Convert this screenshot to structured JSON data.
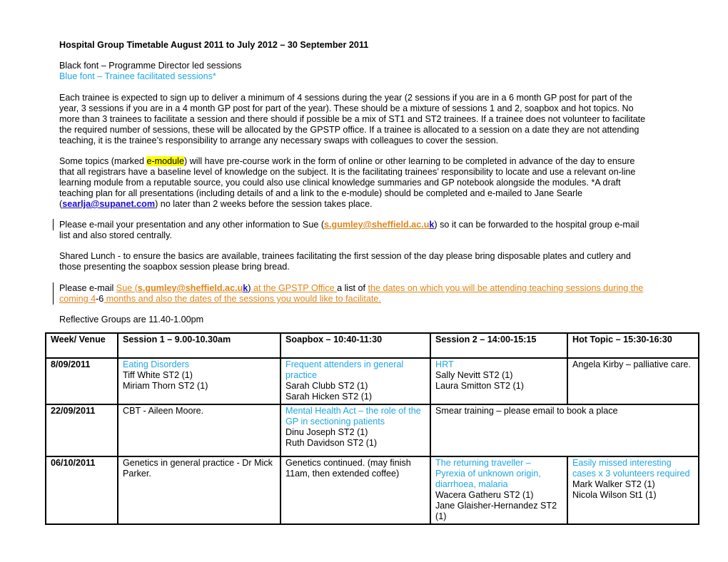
{
  "document": {
    "title": "Hospital Group Timetable August 2011 to July 2012 – 30 September 2011",
    "legend": {
      "black": "Black font – Programme Director led sessions",
      "blue": "Blue font – Trainee facilitated sessions*"
    },
    "paragraph_trainee_lines": [
      "Each trainee is expected to sign up to deliver a minimum of 4 sessions during the year (2 sessions if you are in a 6 month GP post for part of the",
      "year, 3 sessions if you are in a 4 month GP post for part of the year).  These should be a mixture of sessions 1 and 2, soapbox and hot topics. No",
      "more than 3 trainees to facilitate a session and there should if possible be a mix of ST1 and ST2 trainees.  If a trainee does not volunteer to facilitate",
      "the required number of sessions, these will be allocated by the GPSTP office.  If a trainee is allocated to a session on a date they are not attending",
      "teaching, it is the trainee’s responsibility to arrange any necessary swaps with colleagues to cover the session."
    ],
    "emodule": {
      "line1_before": "Some topics (marked ",
      "highlight": "e-module",
      "line1_after": ") will have pre-course work in the form of online or other learning to be completed in advance of the day to ensure",
      "line2": "that all registrars have a baseline level of knowledge on the subject. It is the facilitating trainees’ responsibility to locate and use a relevant on-line",
      "line3": "learning module from a reputable source, you could also use clinical knowledge summaries and GP notebook alongside the modules.  *A draft",
      "line4": "teaching plan for all presentations (including details of and a link to the e-module) should be completed and e-mailed to Jane Searle",
      "line5_open": "(",
      "email": "searlja@supanet.com",
      "line5_after": ") no later than 2 weeks before the session takes place."
    },
    "presentation": {
      "before": "Please e-mail your presentation and any other information to Sue (",
      "email_orange": "s.gumley@sheffield.ac.u",
      "email_blue": "k",
      "after": ") so it can be forwarded to the hospital group e-mail",
      "line2": "list and also stored centrally."
    },
    "lunch": {
      "line1": "Shared Lunch - to ensure the basics are available, trainees facilitating the first session of the day please bring disposable plates and cutlery and",
      "line2": "those presenting the soapbox session please bring bread."
    },
    "dates_request": {
      "before": "Please e-mail ",
      "sue": "Sue (",
      "email_orange": "s.gumley@sheffield.ac.u",
      "email_blue": "k",
      "close": ")",
      "office": " at the GPSTP Office ",
      "middle": "a list of ",
      "dates_text": "the dates on which you will be attending teaching sessions during the ",
      "line2_a": "coming 4",
      "line2_b": "-6",
      "line2_c": " months and also the dates of the sessions you would like to facilitate."
    },
    "reflective": "Reflective Groups are 11.40-1.00pm"
  },
  "timetable": {
    "headers": [
      "Week/ Venue",
      "Session 1 – 9.00-10.30am",
      "Soapbox – 10:40-11:30",
      "Session 2 – 14:00-15:15",
      "Hot Topic – 15:30-16:30"
    ],
    "rows": [
      {
        "date": "8/09/2011",
        "session1": {
          "topic": "Eating Disorders",
          "topic_blue": true,
          "people": [
            "Tiff White ST2 (1)",
            "Miriam Thorn ST2 (1)"
          ]
        },
        "soapbox": {
          "topic": "Frequent attenders in general practice",
          "topic_blue": true,
          "people": [
            "Sarah Clubb ST2 (1)",
            "Sarah Hicken ST2 (1)"
          ]
        },
        "session2": {
          "topic": "HRT",
          "topic_blue": true,
          "people": [
            "Sally Nevitt ST2 (1)",
            "Laura Smitton ST2 (1)"
          ]
        },
        "hot_topic": {
          "topic": "Angela Kirby – palliative care.",
          "topic_blue": false,
          "people": []
        }
      },
      {
        "date": "22/09/2011",
        "session1": {
          "topic": "CBT - Aileen Moore.",
          "topic_blue": false,
          "people": []
        },
        "soapbox": {
          "topic": "Mental Health Act – the role of the GP in sectioning patients",
          "topic_blue": true,
          "people": [
            "Dinu Joseph ST2 (1)",
            "Ruth Davidson ST2 (1)"
          ]
        },
        "afternoon_merged": {
          "topic": "Smear training – please email to book a place",
          "topic_blue": false
        }
      },
      {
        "date": "06/10/2011",
        "session1": {
          "topic": "Genetics in general practice - Dr Mick Parker.",
          "topic_blue": false,
          "people": []
        },
        "soapbox": {
          "topic": "Genetics continued.  (may finish 11am, then extended coffee)",
          "topic_blue": false,
          "people": []
        },
        "session2": {
          "topic": "The returning traveller – Pyrexia of unknown origin, diarrhoea, malaria",
          "topic_blue": true,
          "people": [
            "Wacera Gatheru ST2 (1)",
            "Jane Glaisher-Hernandez ST2 (1)"
          ]
        },
        "hot_topic": {
          "topic": "Easily missed interesting cases x 3 volunteers required",
          "topic_blue": true,
          "people": [
            "Mark Walker ST2 (1)",
            "Nicola Wilson St1 (1)"
          ]
        }
      }
    ]
  },
  "colors": {
    "trainee_blue": "#1ea7e1",
    "link_orange": "#e0861a",
    "link_blue": "#1a0dcc",
    "highlight": "#ffff00"
  }
}
